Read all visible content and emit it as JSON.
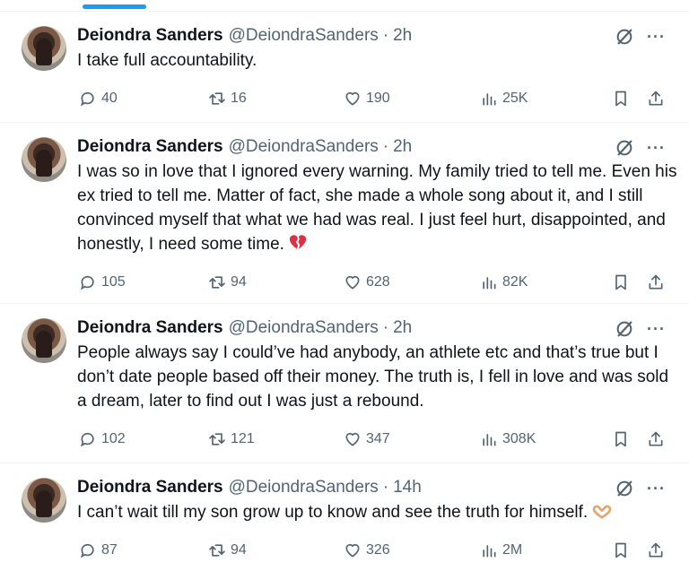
{
  "tweets": [
    {
      "name": "Deiondra Sanders",
      "handle": "@DeiondraSanders",
      "separator": "·",
      "time": "2h",
      "text": "I take full accountability.",
      "emoji": "",
      "replies": "40",
      "retweets": "16",
      "likes": "190",
      "views": "25K"
    },
    {
      "name": "Deiondra Sanders",
      "handle": "@DeiondraSanders",
      "separator": "·",
      "time": "2h",
      "text": "I was so in love that I ignored every warning. My family tried to tell me. Even his ex tried to tell me. Matter of fact, she made a whole song about it, and I still convinced myself that what we had was real. I just feel hurt, disappointed, and honestly, I need some time.",
      "emoji": "broken-heart",
      "replies": "105",
      "retweets": "94",
      "likes": "628",
      "views": "82K"
    },
    {
      "name": "Deiondra Sanders",
      "handle": "@DeiondraSanders",
      "separator": "·",
      "time": "2h",
      "text": "People always say I could’ve had anybody, an athlete etc and that’s true but I don’t date people based off their money. The truth is, I fell in love and was sold a dream, later to find out I was just a rebound.",
      "emoji": "",
      "replies": "102",
      "retweets": "121",
      "likes": "347",
      "views": "308K"
    },
    {
      "name": "Deiondra Sanders",
      "handle": "@DeiondraSanders",
      "separator": "·",
      "time": "14h",
      "text": "I can’t wait till my son grow up to know and see the truth for himself.",
      "emoji": "heart-hands",
      "replies": "87",
      "retweets": "94",
      "likes": "326",
      "views": "2M"
    }
  ],
  "icons": {
    "more": "···",
    "accent": "#1d9bf0",
    "muted": "#536471"
  }
}
